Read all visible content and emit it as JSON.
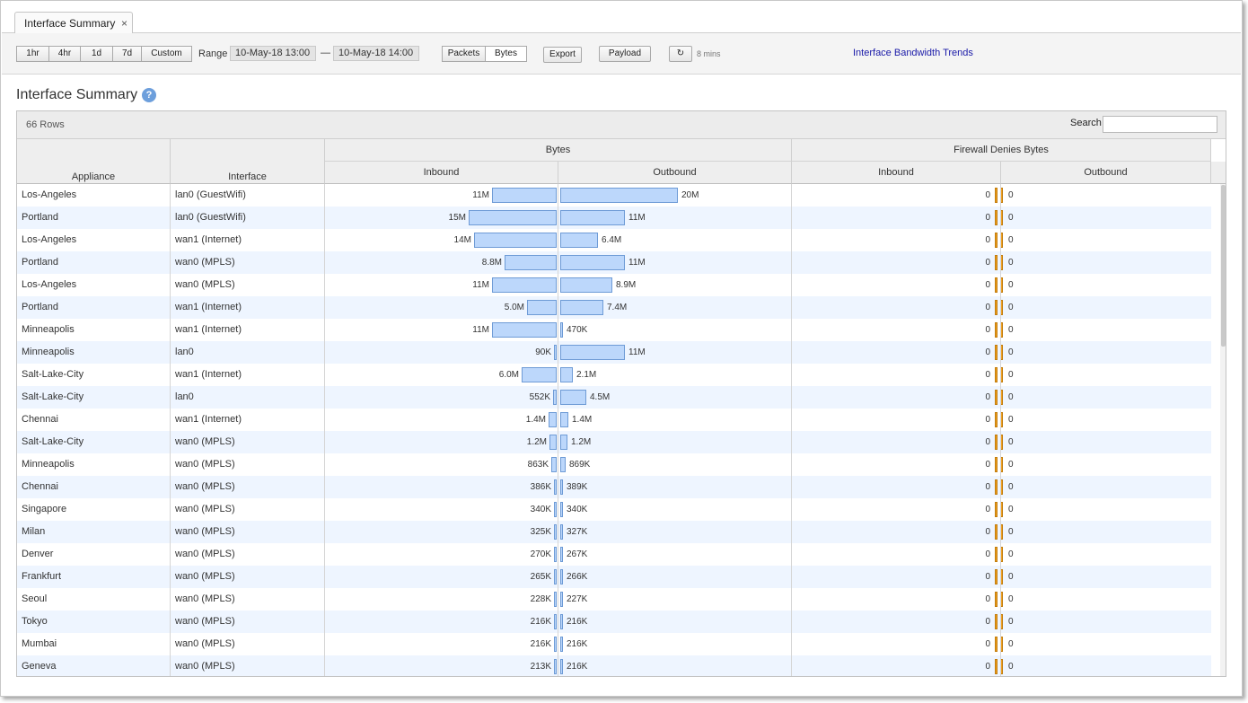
{
  "tab": {
    "title": "Interface Summary",
    "close": "×"
  },
  "toolbar": {
    "ranges": [
      "1hr",
      "4hr",
      "1d",
      "7d",
      "Custom"
    ],
    "range_label": "Range",
    "from": "10-May-18 13:00",
    "dash": "—",
    "to": "10-May-18 14:00",
    "units": [
      "Packets",
      "Bytes"
    ],
    "selected_unit": "Bytes",
    "export": "Export",
    "payload": "Payload",
    "refresh_icon": "↻",
    "refresh_interval": "8 mins",
    "trends_link": "Interface Bandwidth Trends"
  },
  "page": {
    "title": "Interface Summary",
    "help": "?"
  },
  "grid": {
    "rows_count": "66 Rows",
    "search_label": "Search",
    "search_value": "",
    "group_headers": {
      "bytes": "Bytes",
      "fw": "Firewall Denies Bytes"
    },
    "columns": {
      "appliance": "Appliance",
      "interface": "Interface",
      "inbound": "Inbound",
      "outbound": "Outbound",
      "fw_inbound": "Inbound",
      "fw_outbound": "Outbound"
    },
    "colors": {
      "bar_fill": "#bcd7fb",
      "bar_border": "#6e9bd6",
      "fw_bar": "#f0a020",
      "alt_row": "#eef5ff"
    },
    "rows": [
      {
        "appliance": "Los-Angeles",
        "interface": "lan0 (GuestWifi)",
        "inbound": "11M",
        "in_val": 11000000,
        "outbound": "20M",
        "out_val": 20000000,
        "fw_in": "0",
        "fw_out": "0"
      },
      {
        "appliance": "Portland",
        "interface": "lan0 (GuestWifi)",
        "inbound": "15M",
        "in_val": 15000000,
        "outbound": "11M",
        "out_val": 11000000,
        "fw_in": "0",
        "fw_out": "0"
      },
      {
        "appliance": "Los-Angeles",
        "interface": "wan1 (Internet)",
        "inbound": "14M",
        "in_val": 14000000,
        "outbound": "6.4M",
        "out_val": 6400000,
        "fw_in": "0",
        "fw_out": "0"
      },
      {
        "appliance": "Portland",
        "interface": "wan0 (MPLS)",
        "inbound": "8.8M",
        "in_val": 8800000,
        "outbound": "11M",
        "out_val": 11000000,
        "fw_in": "0",
        "fw_out": "0"
      },
      {
        "appliance": "Los-Angeles",
        "interface": "wan0 (MPLS)",
        "inbound": "11M",
        "in_val": 11000000,
        "outbound": "8.9M",
        "out_val": 8900000,
        "fw_in": "0",
        "fw_out": "0"
      },
      {
        "appliance": "Portland",
        "interface": "wan1 (Internet)",
        "inbound": "5.0M",
        "in_val": 5000000,
        "outbound": "7.4M",
        "out_val": 7400000,
        "fw_in": "0",
        "fw_out": "0"
      },
      {
        "appliance": "Minneapolis",
        "interface": "wan1 (Internet)",
        "inbound": "11M",
        "in_val": 11000000,
        "outbound": "470K",
        "out_val": 470000,
        "fw_in": "0",
        "fw_out": "0"
      },
      {
        "appliance": "Minneapolis",
        "interface": "lan0",
        "inbound": "90K",
        "in_val": 90000,
        "outbound": "11M",
        "out_val": 11000000,
        "fw_in": "0",
        "fw_out": "0"
      },
      {
        "appliance": "Salt-Lake-City",
        "interface": "wan1 (Internet)",
        "inbound": "6.0M",
        "in_val": 6000000,
        "outbound": "2.1M",
        "out_val": 2100000,
        "fw_in": "0",
        "fw_out": "0"
      },
      {
        "appliance": "Salt-Lake-City",
        "interface": "lan0",
        "inbound": "552K",
        "in_val": 552000,
        "outbound": "4.5M",
        "out_val": 4500000,
        "fw_in": "0",
        "fw_out": "0"
      },
      {
        "appliance": "Chennai",
        "interface": "wan1 (Internet)",
        "inbound": "1.4M",
        "in_val": 1400000,
        "outbound": "1.4M",
        "out_val": 1400000,
        "fw_in": "0",
        "fw_out": "0"
      },
      {
        "appliance": "Salt-Lake-City",
        "interface": "wan0 (MPLS)",
        "inbound": "1.2M",
        "in_val": 1200000,
        "outbound": "1.2M",
        "out_val": 1200000,
        "fw_in": "0",
        "fw_out": "0"
      },
      {
        "appliance": "Minneapolis",
        "interface": "wan0 (MPLS)",
        "inbound": "863K",
        "in_val": 863000,
        "outbound": "869K",
        "out_val": 869000,
        "fw_in": "0",
        "fw_out": "0"
      },
      {
        "appliance": "Chennai",
        "interface": "wan0 (MPLS)",
        "inbound": "386K",
        "in_val": 386000,
        "outbound": "389K",
        "out_val": 389000,
        "fw_in": "0",
        "fw_out": "0"
      },
      {
        "appliance": "Singapore",
        "interface": "wan0 (MPLS)",
        "inbound": "340K",
        "in_val": 340000,
        "outbound": "340K",
        "out_val": 340000,
        "fw_in": "0",
        "fw_out": "0"
      },
      {
        "appliance": "Milan",
        "interface": "wan0 (MPLS)",
        "inbound": "325K",
        "in_val": 325000,
        "outbound": "327K",
        "out_val": 327000,
        "fw_in": "0",
        "fw_out": "0"
      },
      {
        "appliance": "Denver",
        "interface": "wan0 (MPLS)",
        "inbound": "270K",
        "in_val": 270000,
        "outbound": "267K",
        "out_val": 267000,
        "fw_in": "0",
        "fw_out": "0"
      },
      {
        "appliance": "Frankfurt",
        "interface": "wan0 (MPLS)",
        "inbound": "265K",
        "in_val": 265000,
        "outbound": "266K",
        "out_val": 266000,
        "fw_in": "0",
        "fw_out": "0"
      },
      {
        "appliance": "Seoul",
        "interface": "wan0 (MPLS)",
        "inbound": "228K",
        "in_val": 228000,
        "outbound": "227K",
        "out_val": 227000,
        "fw_in": "0",
        "fw_out": "0"
      },
      {
        "appliance": "Tokyo",
        "interface": "wan0 (MPLS)",
        "inbound": "216K",
        "in_val": 216000,
        "outbound": "216K",
        "out_val": 216000,
        "fw_in": "0",
        "fw_out": "0"
      },
      {
        "appliance": "Mumbai",
        "interface": "wan0 (MPLS)",
        "inbound": "216K",
        "in_val": 216000,
        "outbound": "216K",
        "out_val": 216000,
        "fw_in": "0",
        "fw_out": "0"
      },
      {
        "appliance": "Geneva",
        "interface": "wan0 (MPLS)",
        "inbound": "213K",
        "in_val": 213000,
        "outbound": "216K",
        "out_val": 216000,
        "fw_in": "0",
        "fw_out": "0"
      }
    ]
  }
}
